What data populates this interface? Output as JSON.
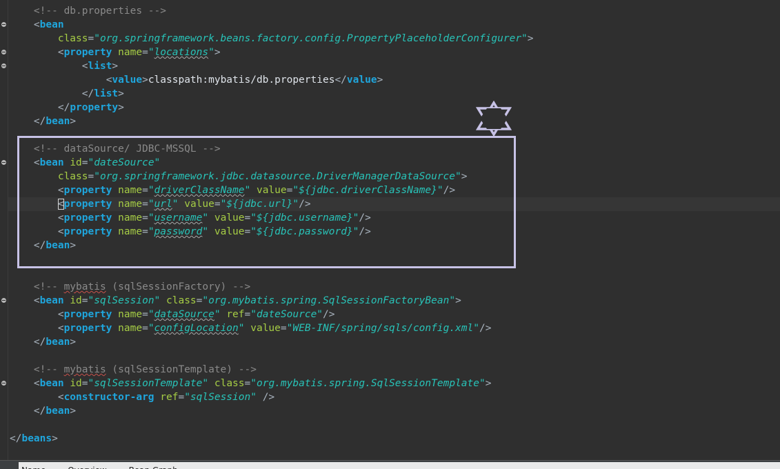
{
  "editor": {
    "lines": [
      {
        "fold": false,
        "current": false,
        "tokens": [
          {
            "t": "    ",
            "c": "tx"
          },
          {
            "t": "<!-- db.properties -->",
            "c": "cm"
          }
        ]
      },
      {
        "fold": true,
        "current": false,
        "tokens": [
          {
            "t": "    ",
            "c": "tx"
          },
          {
            "t": "<",
            "c": "br"
          },
          {
            "t": "bean",
            "c": "tg"
          }
        ]
      },
      {
        "fold": false,
        "current": false,
        "tokens": [
          {
            "t": "        ",
            "c": "tx"
          },
          {
            "t": "class",
            "c": "an"
          },
          {
            "t": "=",
            "c": "br"
          },
          {
            "t": "\"org.springframework.beans.factory.config.PropertyPlaceholderConfigurer\"",
            "c": "av"
          },
          {
            "t": ">",
            "c": "br"
          }
        ]
      },
      {
        "fold": true,
        "current": false,
        "tokens": [
          {
            "t": "        ",
            "c": "tx"
          },
          {
            "t": "<",
            "c": "br"
          },
          {
            "t": "property",
            "c": "tg"
          },
          {
            "t": " ",
            "c": "tx"
          },
          {
            "t": "name",
            "c": "an"
          },
          {
            "t": "=",
            "c": "br"
          },
          {
            "t": "\"",
            "c": "av"
          },
          {
            "t": "locations",
            "c": "av",
            "sq": "i"
          },
          {
            "t": "\"",
            "c": "av"
          },
          {
            "t": ">",
            "c": "br"
          }
        ]
      },
      {
        "fold": true,
        "current": false,
        "tokens": [
          {
            "t": "            ",
            "c": "tx"
          },
          {
            "t": "<",
            "c": "br"
          },
          {
            "t": "list",
            "c": "tg"
          },
          {
            "t": ">",
            "c": "br"
          }
        ]
      },
      {
        "fold": false,
        "current": false,
        "tokens": [
          {
            "t": "                ",
            "c": "tx"
          },
          {
            "t": "<",
            "c": "br"
          },
          {
            "t": "value",
            "c": "tg"
          },
          {
            "t": ">",
            "c": "br"
          },
          {
            "t": "classpath:mybatis/db.properties",
            "c": "tx"
          },
          {
            "t": "</",
            "c": "br"
          },
          {
            "t": "value",
            "c": "tg"
          },
          {
            "t": ">",
            "c": "br"
          }
        ]
      },
      {
        "fold": false,
        "current": false,
        "tokens": [
          {
            "t": "            ",
            "c": "tx"
          },
          {
            "t": "</",
            "c": "br"
          },
          {
            "t": "list",
            "c": "tg"
          },
          {
            "t": ">",
            "c": "br"
          }
        ]
      },
      {
        "fold": false,
        "current": false,
        "tokens": [
          {
            "t": "        ",
            "c": "tx"
          },
          {
            "t": "</",
            "c": "br"
          },
          {
            "t": "property",
            "c": "tg"
          },
          {
            "t": ">",
            "c": "br"
          }
        ]
      },
      {
        "fold": false,
        "current": false,
        "tokens": [
          {
            "t": "    ",
            "c": "tx"
          },
          {
            "t": "</",
            "c": "br"
          },
          {
            "t": "bean",
            "c": "tg"
          },
          {
            "t": ">",
            "c": "br"
          }
        ]
      },
      {
        "fold": false,
        "current": false,
        "tokens": []
      },
      {
        "fold": false,
        "current": false,
        "tokens": [
          {
            "t": "    ",
            "c": "tx"
          },
          {
            "t": "<!-- dataSource/ JDBC-MSSQL -->",
            "c": "cm"
          }
        ]
      },
      {
        "fold": true,
        "current": false,
        "tokens": [
          {
            "t": "    ",
            "c": "tx"
          },
          {
            "t": "<",
            "c": "br"
          },
          {
            "t": "bean",
            "c": "tg"
          },
          {
            "t": " ",
            "c": "tx"
          },
          {
            "t": "id",
            "c": "an"
          },
          {
            "t": "=",
            "c": "br"
          },
          {
            "t": "\"dateSource\"",
            "c": "av"
          }
        ]
      },
      {
        "fold": false,
        "current": false,
        "tokens": [
          {
            "t": "        ",
            "c": "tx"
          },
          {
            "t": "class",
            "c": "an"
          },
          {
            "t": "=",
            "c": "br"
          },
          {
            "t": "\"org.springframework.jdbc.datasource.DriverManagerDataSource\"",
            "c": "av"
          },
          {
            "t": ">",
            "c": "br"
          }
        ]
      },
      {
        "fold": false,
        "current": false,
        "tokens": [
          {
            "t": "        ",
            "c": "tx"
          },
          {
            "t": "<",
            "c": "br"
          },
          {
            "t": "property",
            "c": "tg"
          },
          {
            "t": " ",
            "c": "tx"
          },
          {
            "t": "name",
            "c": "an"
          },
          {
            "t": "=",
            "c": "br"
          },
          {
            "t": "\"",
            "c": "av"
          },
          {
            "t": "driverClassName",
            "c": "av",
            "sq": "i"
          },
          {
            "t": "\"",
            "c": "av"
          },
          {
            "t": " ",
            "c": "tx"
          },
          {
            "t": "value",
            "c": "an"
          },
          {
            "t": "=",
            "c": "br"
          },
          {
            "t": "\"${jdbc.driverClassName}\"",
            "c": "av"
          },
          {
            "t": "/>",
            "c": "br"
          }
        ]
      },
      {
        "fold": false,
        "current": true,
        "tokens": [
          {
            "t": "        ",
            "c": "tx"
          },
          {
            "t": "<",
            "c": "br",
            "caret": true
          },
          {
            "t": "property",
            "c": "tg"
          },
          {
            "t": " ",
            "c": "tx"
          },
          {
            "t": "name",
            "c": "an"
          },
          {
            "t": "=",
            "c": "br"
          },
          {
            "t": "\"",
            "c": "av"
          },
          {
            "t": "url",
            "c": "av",
            "sq": "i"
          },
          {
            "t": "\"",
            "c": "av"
          },
          {
            "t": " ",
            "c": "tx"
          },
          {
            "t": "value",
            "c": "an"
          },
          {
            "t": "=",
            "c": "br"
          },
          {
            "t": "\"${jdbc.url}\"",
            "c": "av"
          },
          {
            "t": "/>",
            "c": "br"
          }
        ]
      },
      {
        "fold": false,
        "current": false,
        "tokens": [
          {
            "t": "        ",
            "c": "tx"
          },
          {
            "t": "<",
            "c": "br"
          },
          {
            "t": "property",
            "c": "tg"
          },
          {
            "t": " ",
            "c": "tx"
          },
          {
            "t": "name",
            "c": "an"
          },
          {
            "t": "=",
            "c": "br"
          },
          {
            "t": "\"",
            "c": "av"
          },
          {
            "t": "username",
            "c": "av",
            "sq": "i"
          },
          {
            "t": "\"",
            "c": "av"
          },
          {
            "t": " ",
            "c": "tx"
          },
          {
            "t": "value",
            "c": "an"
          },
          {
            "t": "=",
            "c": "br"
          },
          {
            "t": "\"${jdbc.username}\"",
            "c": "av"
          },
          {
            "t": "/>",
            "c": "br"
          }
        ]
      },
      {
        "fold": false,
        "current": false,
        "tokens": [
          {
            "t": "        ",
            "c": "tx"
          },
          {
            "t": "<",
            "c": "br"
          },
          {
            "t": "property",
            "c": "tg"
          },
          {
            "t": " ",
            "c": "tx"
          },
          {
            "t": "name",
            "c": "an"
          },
          {
            "t": "=",
            "c": "br"
          },
          {
            "t": "\"",
            "c": "av"
          },
          {
            "t": "password",
            "c": "av",
            "sq": "i"
          },
          {
            "t": "\"",
            "c": "av"
          },
          {
            "t": " ",
            "c": "tx"
          },
          {
            "t": "value",
            "c": "an"
          },
          {
            "t": "=",
            "c": "br"
          },
          {
            "t": "\"${jdbc.password}\"",
            "c": "av"
          },
          {
            "t": "/>",
            "c": "br"
          }
        ]
      },
      {
        "fold": false,
        "current": false,
        "tokens": [
          {
            "t": "    ",
            "c": "tx"
          },
          {
            "t": "</",
            "c": "br"
          },
          {
            "t": "bean",
            "c": "tg"
          },
          {
            "t": ">",
            "c": "br"
          }
        ]
      },
      {
        "fold": false,
        "current": false,
        "tokens": []
      },
      {
        "fold": false,
        "current": false,
        "tokens": []
      },
      {
        "fold": false,
        "current": false,
        "tokens": [
          {
            "t": "    ",
            "c": "tx"
          },
          {
            "t": "<!-- ",
            "c": "cm"
          },
          {
            "t": "mybatis",
            "c": "cm",
            "sq": "r"
          },
          {
            "t": " (sqlSessionFactory) -->",
            "c": "cm"
          }
        ]
      },
      {
        "fold": true,
        "current": false,
        "tokens": [
          {
            "t": "    ",
            "c": "tx"
          },
          {
            "t": "<",
            "c": "br"
          },
          {
            "t": "bean",
            "c": "tg"
          },
          {
            "t": " ",
            "c": "tx"
          },
          {
            "t": "id",
            "c": "an"
          },
          {
            "t": "=",
            "c": "br"
          },
          {
            "t": "\"sqlSession\"",
            "c": "av"
          },
          {
            "t": " ",
            "c": "tx"
          },
          {
            "t": "class",
            "c": "an"
          },
          {
            "t": "=",
            "c": "br"
          },
          {
            "t": "\"org.mybatis.spring.SqlSessionFactoryBean\"",
            "c": "av"
          },
          {
            "t": ">",
            "c": "br"
          }
        ]
      },
      {
        "fold": false,
        "current": false,
        "tokens": [
          {
            "t": "        ",
            "c": "tx"
          },
          {
            "t": "<",
            "c": "br"
          },
          {
            "t": "property",
            "c": "tg"
          },
          {
            "t": " ",
            "c": "tx"
          },
          {
            "t": "name",
            "c": "an"
          },
          {
            "t": "=",
            "c": "br"
          },
          {
            "t": "\"",
            "c": "av"
          },
          {
            "t": "dataSource",
            "c": "av",
            "sq": "i"
          },
          {
            "t": "\"",
            "c": "av"
          },
          {
            "t": " ",
            "c": "tx"
          },
          {
            "t": "ref",
            "c": "an"
          },
          {
            "t": "=",
            "c": "br"
          },
          {
            "t": "\"dateSource\"",
            "c": "av"
          },
          {
            "t": "/>",
            "c": "br"
          }
        ]
      },
      {
        "fold": false,
        "current": false,
        "tokens": [
          {
            "t": "        ",
            "c": "tx"
          },
          {
            "t": "<",
            "c": "br"
          },
          {
            "t": "property",
            "c": "tg"
          },
          {
            "t": " ",
            "c": "tx"
          },
          {
            "t": "name",
            "c": "an"
          },
          {
            "t": "=",
            "c": "br"
          },
          {
            "t": "\"",
            "c": "av"
          },
          {
            "t": "configLocation",
            "c": "av",
            "sq": "i"
          },
          {
            "t": "\"",
            "c": "av"
          },
          {
            "t": " ",
            "c": "tx"
          },
          {
            "t": "value",
            "c": "an"
          },
          {
            "t": "=",
            "c": "br"
          },
          {
            "t": "\"WEB-INF/spring/sqls/config.xml\"",
            "c": "av"
          },
          {
            "t": "/>",
            "c": "br"
          }
        ]
      },
      {
        "fold": false,
        "current": false,
        "tokens": [
          {
            "t": "    ",
            "c": "tx"
          },
          {
            "t": "</",
            "c": "br"
          },
          {
            "t": "bean",
            "c": "tg"
          },
          {
            "t": ">",
            "c": "br"
          }
        ]
      },
      {
        "fold": false,
        "current": false,
        "tokens": []
      },
      {
        "fold": false,
        "current": false,
        "tokens": [
          {
            "t": "    ",
            "c": "tx"
          },
          {
            "t": "<!-- ",
            "c": "cm"
          },
          {
            "t": "mybatis",
            "c": "cm",
            "sq": "r"
          },
          {
            "t": " (sqlSessionTemplate) -->",
            "c": "cm"
          }
        ]
      },
      {
        "fold": true,
        "current": false,
        "tokens": [
          {
            "t": "    ",
            "c": "tx"
          },
          {
            "t": "<",
            "c": "br"
          },
          {
            "t": "bean",
            "c": "tg"
          },
          {
            "t": " ",
            "c": "tx"
          },
          {
            "t": "id",
            "c": "an"
          },
          {
            "t": "=",
            "c": "br"
          },
          {
            "t": "\"sqlSessionTemplate\"",
            "c": "av"
          },
          {
            "t": " ",
            "c": "tx"
          },
          {
            "t": "class",
            "c": "an"
          },
          {
            "t": "=",
            "c": "br"
          },
          {
            "t": "\"org.mybatis.spring.SqlSessionTemplate\"",
            "c": "av"
          },
          {
            "t": ">",
            "c": "br"
          }
        ]
      },
      {
        "fold": false,
        "current": false,
        "tokens": [
          {
            "t": "        ",
            "c": "tx"
          },
          {
            "t": "<",
            "c": "br"
          },
          {
            "t": "constructor-arg",
            "c": "tg"
          },
          {
            "t": " ",
            "c": "tx"
          },
          {
            "t": "ref",
            "c": "an"
          },
          {
            "t": "=",
            "c": "br"
          },
          {
            "t": "\"sqlSession\"",
            "c": "av"
          },
          {
            "t": " />",
            "c": "br"
          }
        ]
      },
      {
        "fold": false,
        "current": false,
        "tokens": [
          {
            "t": "    ",
            "c": "tx"
          },
          {
            "t": "</",
            "c": "br"
          },
          {
            "t": "bean",
            "c": "tg"
          },
          {
            "t": ">",
            "c": "br"
          }
        ]
      },
      {
        "fold": false,
        "current": false,
        "tokens": []
      },
      {
        "fold": false,
        "current": false,
        "tokens": [
          {
            "t": "</",
            "c": "br"
          },
          {
            "t": "beans",
            "c": "tg"
          },
          {
            "t": ">",
            "c": "br"
          }
        ]
      }
    ]
  },
  "statusbar": {
    "tabs": [
      "Name",
      "Overview",
      "Bean Graph"
    ]
  },
  "colors": {
    "background": "#2f2f2f",
    "tag": "#1fa6dd",
    "attribute": "#a6cd45",
    "value": "#28c3b8",
    "comment": "#8a8a8a",
    "highlight_box": "#c7c2e6"
  }
}
